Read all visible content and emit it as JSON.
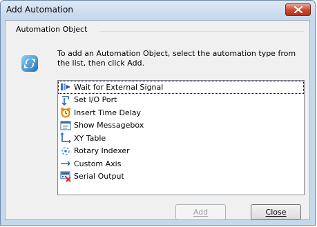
{
  "window": {
    "title": "Add Automation"
  },
  "group": {
    "label": "Automation Object",
    "description": "To add an Automation Object, select the automation type from the list, then click Add."
  },
  "list": {
    "items": [
      {
        "label": "Wait for External Signal",
        "icon": "signal-icon",
        "selected": true
      },
      {
        "label": "Set I/O Port",
        "icon": "io-port-icon",
        "selected": false
      },
      {
        "label": "Insert Time Delay",
        "icon": "alarm-clock-icon",
        "selected": false
      },
      {
        "label": "Show Messagebox",
        "icon": "messagebox-icon",
        "selected": false
      },
      {
        "label": "XY Table",
        "icon": "xy-axes-icon",
        "selected": false
      },
      {
        "label": "Rotary Indexer",
        "icon": "rotary-icon",
        "selected": false
      },
      {
        "label": "Custom Axis",
        "icon": "axis-arrow-icon",
        "selected": false
      },
      {
        "label": "Serial Output",
        "icon": "serial-output-icon",
        "selected": false
      }
    ]
  },
  "buttons": {
    "add": "Add",
    "close": "Close"
  },
  "colors": {
    "titlebar": "#c3d6ec",
    "close_button": "#c9462c",
    "dialog_background": "#f0f0f0"
  }
}
